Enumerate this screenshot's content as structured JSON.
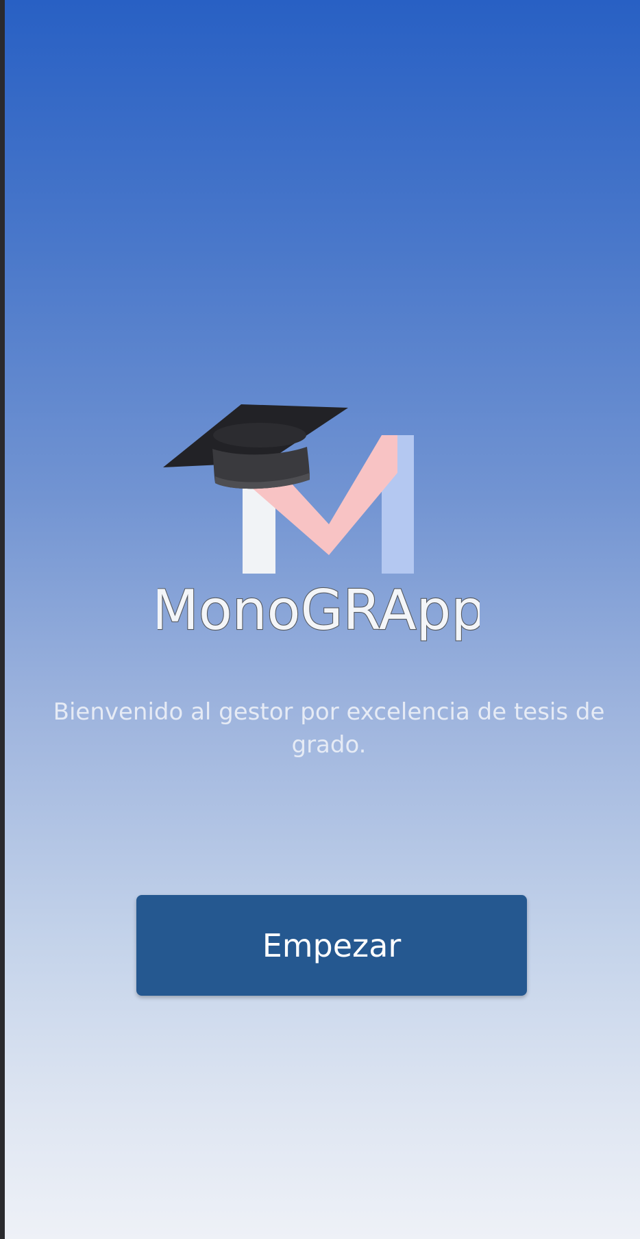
{
  "screen": {
    "background_top": "#2860c4",
    "background_bottom": "#eef1f7"
  },
  "logo": {
    "wordmark": "MonoGRApp",
    "icon": "graduation-cap-icon",
    "m_colors": [
      "#f1f3f6",
      "#f8c3c4",
      "#b4c8f1"
    ]
  },
  "welcome": {
    "text": "Bienvenido al gestor por excelencia de tesis de grado."
  },
  "start_button": {
    "label": "Empezar",
    "color": "#255890"
  }
}
